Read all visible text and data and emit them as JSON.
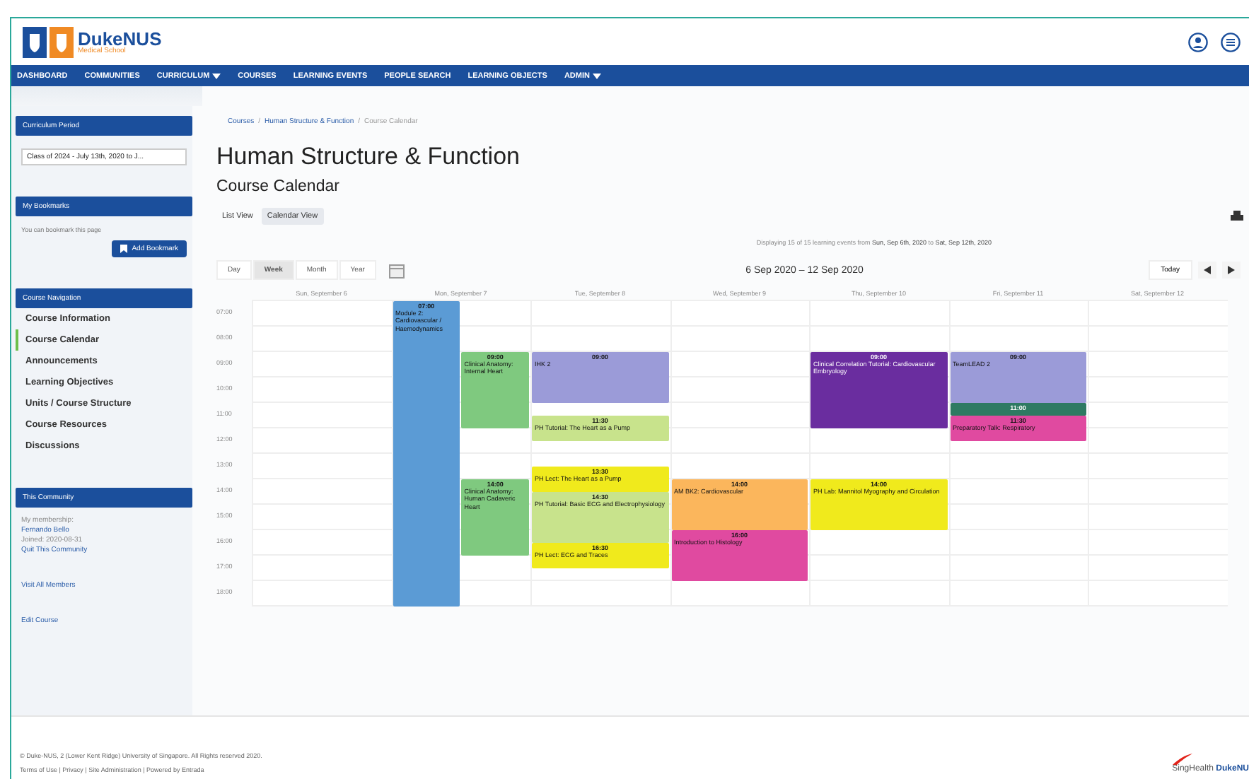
{
  "header": {
    "logo_name": "DukeNUS",
    "logo_sub": "Medical School"
  },
  "nav": [
    {
      "label": "DASHBOARD",
      "dropdown": false
    },
    {
      "label": "COMMUNITIES",
      "dropdown": false
    },
    {
      "label": "CURRICULUM",
      "dropdown": true
    },
    {
      "label": "COURSES",
      "dropdown": false
    },
    {
      "label": "LEARNING EVENTS",
      "dropdown": false
    },
    {
      "label": "PEOPLE SEARCH",
      "dropdown": false
    },
    {
      "label": "LEARNING OBJECTS",
      "dropdown": false
    },
    {
      "label": "ADMIN",
      "dropdown": true
    }
  ],
  "sidebar": {
    "curriculum_period": {
      "title": "Curriculum Period",
      "value": "Class of 2024 - July 13th, 2020 to J..."
    },
    "bookmarks": {
      "title": "My Bookmarks",
      "text": "You can bookmark this page",
      "button": "Add Bookmark"
    },
    "course_navigation": {
      "title": "Course Navigation",
      "items": [
        {
          "label": "Course Information",
          "selected": false
        },
        {
          "label": "Course Calendar",
          "selected": true
        },
        {
          "label": "Announcements",
          "selected": false
        },
        {
          "label": "Learning Objectives",
          "selected": false
        },
        {
          "label": "Units / Course Structure",
          "selected": false
        },
        {
          "label": "Course Resources",
          "selected": false
        },
        {
          "label": "Discussions",
          "selected": false
        }
      ]
    },
    "community": {
      "title": "This Community",
      "membership_label": "My membership:",
      "member": "Fernando Bello",
      "joined": "Joined: 2020-08-31",
      "quit": "Quit This Community",
      "visit": "Visit All Members",
      "edit": "Edit Course"
    }
  },
  "breadcrumb": [
    {
      "label": "Courses",
      "link": true
    },
    {
      "separator": "/",
      "label": "Human Structure & Function",
      "link": true
    },
    {
      "separator": "/",
      "label": "Course Calendar",
      "link": false
    }
  ],
  "title": "Human Structure & Function",
  "subtitle": "Course Calendar",
  "tabs": [
    {
      "label": "List View",
      "selected": false
    },
    {
      "label": "Calendar View",
      "selected": true
    }
  ],
  "info": "Displaying 15 of 15 learning events from **Sun, Sep 6th, 2020** to **Sat, Sep 12th, 2020**",
  "calendar": {
    "views": [
      {
        "label": "Day",
        "selected": false
      },
      {
        "label": "Week",
        "selected": true
      },
      {
        "label": "Month",
        "selected": false
      },
      {
        "label": "Year",
        "selected": false
      }
    ],
    "range": "6 Sep 2020 – 12 Sep 2020",
    "today": "Today",
    "hours": [
      "07:00",
      "08:00",
      "09:00",
      "10:00",
      "11:00",
      "12:00",
      "13:00",
      "14:00",
      "15:00",
      "16:00",
      "17:00",
      "18:00"
    ],
    "days": [
      {
        "label": "Sun, September 6"
      },
      {
        "label": "Mon, September 7",
        "lanes": [
          [
            {
              "kind": "all-day",
              "time": "07:00",
              "title": "Module 2: Cardiovascular / Haemodynamics",
              "color": "#5b9bd5"
            }
          ],
          [
            {
              "kind": "three-hour",
              "time": "09:00",
              "title": "Clinical Anatomy: Internal Heart",
              "color": "#7fc97f"
            },
            {
              "kind": "three-hour",
              "time": "14:00",
              "title": "Clinical Anatomy: Human Cadaveric Heart",
              "color": "#7fc97f"
            }
          ]
        ]
      },
      {
        "label": "Tue, September 8",
        "lanes": [
          [
            {
              "kind": "two-hour",
              "time": "09:00",
              "title": "IHK 2",
              "color": "#9b9bd8"
            },
            {
              "kind": "hour",
              "time": "11:30",
              "title": "PH Tutorial: The Heart as a Pump",
              "color": "#c8e38c"
            },
            {
              "kind": "hour",
              "time": "13:30",
              "title": "PH Lect: The Heart as a Pump",
              "color": "#f0ea1c"
            },
            {
              "kind": "two-hour",
              "time": "14:30",
              "title": "PH Tutorial: Basic ECG and Electrophysiology",
              "color": "#c8e38c"
            },
            {
              "kind": "hour",
              "time": "16:30",
              "title": "PH Lect: ECG and Traces",
              "color": "#f0ea1c"
            }
          ]
        ]
      },
      {
        "label": "Wed, September 9",
        "lanes": [
          [
            {
              "kind": "two-hour",
              "time": "14:00",
              "title": "AM BK2: Cardiovascular",
              "color": "#fbb65c"
            },
            {
              "kind": "two-hour",
              "time": "16:00",
              "title": "Introduction to Histology",
              "color": "#e04aa0"
            }
          ]
        ]
      },
      {
        "label": "Thu, September 10",
        "lanes": [
          [
            {
              "kind": "three-hour",
              "time": "09:00",
              "title": "Clinical Correlation Tutorial: Cardiovascular Embryology",
              "color": "#6a2d9f"
            },
            {
              "kind": "two-hour",
              "time": "14:00",
              "title": "PH Lab: Mannitol Myography and Circulation",
              "color": "#f0ea1c"
            }
          ]
        ]
      },
      {
        "label": "Fri, September 11",
        "lanes": [
          [
            {
              "kind": "two-hour",
              "time": "09:00",
              "title": "TeamLEAD 2",
              "color": "#9b9bd8"
            },
            {
              "kind": "half-hour",
              "time": "11:00",
              "color": "#2e7a62"
            },
            {
              "kind": "hour",
              "time": "11:30",
              "title": "Preparatory Talk: Respiratory",
              "color": "#e04aa0"
            }
          ]
        ]
      },
      {
        "label": "Sat, September 12"
      }
    ]
  },
  "footer": {
    "copyright": "© Duke-NUS, 2 (Lower Kent Ridge) University of Singapore. All Rights reserved 2020.",
    "links": "Terms of Use | Privacy | Site Administration | Powered by Entrada",
    "logo_a": "SingHealth",
    "logo_b": "DukeNU"
  }
}
